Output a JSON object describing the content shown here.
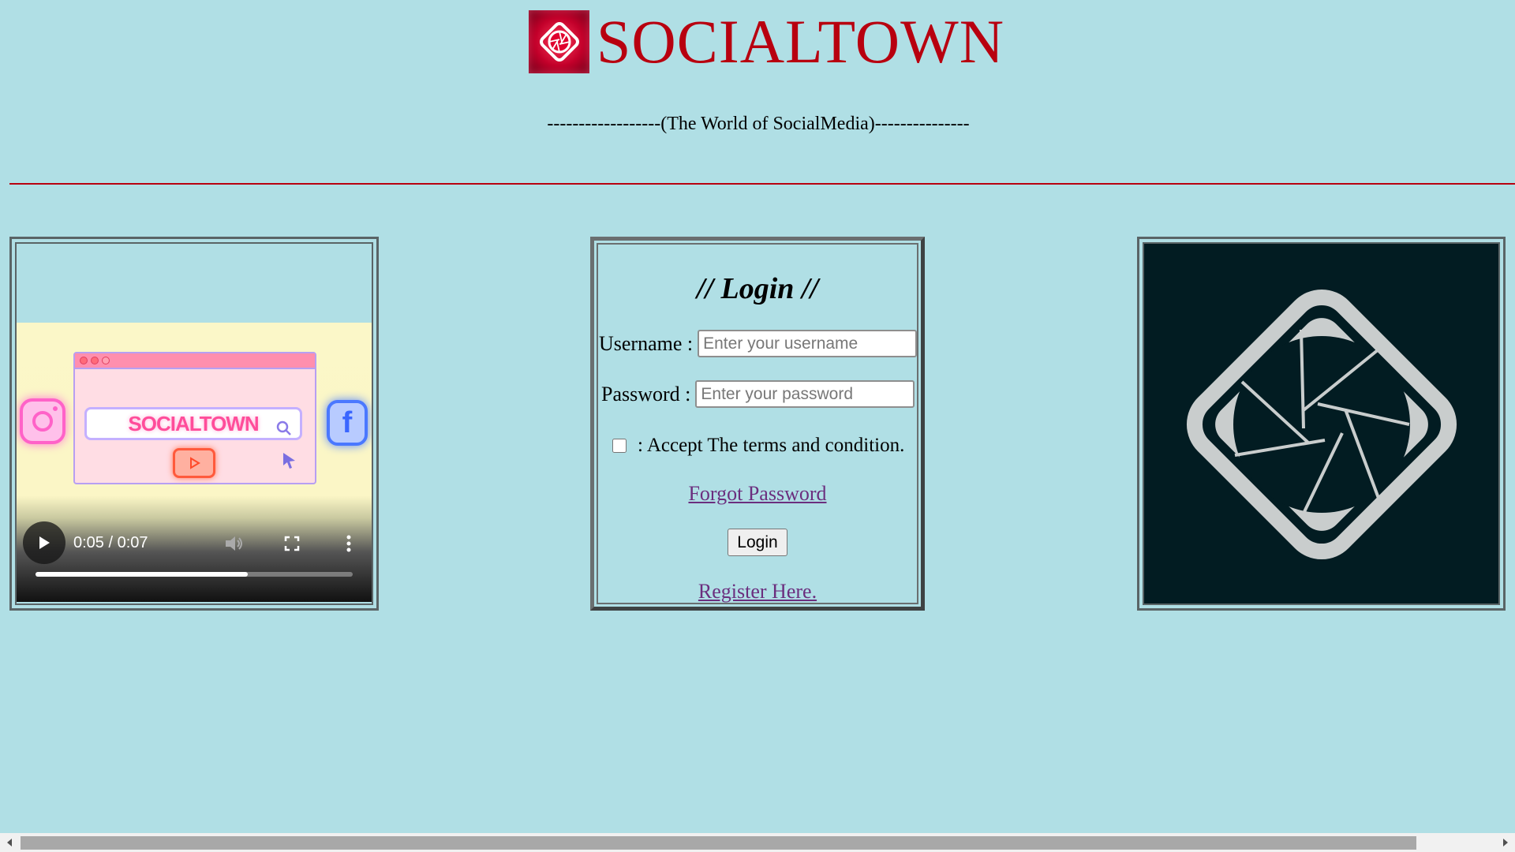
{
  "header": {
    "brand_name": "SOCIALTOWN",
    "tagline": "------------------(The World of SocialMedia)---------------",
    "logo_icon": "camera-aperture-icon",
    "brand_color": "#b8000f"
  },
  "video": {
    "thumbnail_text": "SOCIALTOWN",
    "current_time": "0:05",
    "duration": "0:07",
    "time_display": "0:05 / 0:07",
    "progress_fraction": 0.67,
    "icons": [
      "play-icon",
      "volume-icon",
      "fullscreen-icon",
      "more-options-icon",
      "instagram-icon",
      "facebook-icon",
      "youtube-icon",
      "search-icon",
      "cursor-icon"
    ]
  },
  "login": {
    "title": "// Login //",
    "username_label": "Username :",
    "username_placeholder": "Enter your username",
    "password_label": "Password :",
    "password_placeholder": "Enter your password",
    "terms_text": ": Accept The terms and condition.",
    "forgot_link": "Forgot Password",
    "login_button": "Login",
    "register_link": "Register Here."
  },
  "logo_image": {
    "icon": "camera-aperture-icon"
  },
  "colors": {
    "background": "#b0dfe5",
    "link": "#6b2e7e",
    "divider": "#b8000f"
  }
}
